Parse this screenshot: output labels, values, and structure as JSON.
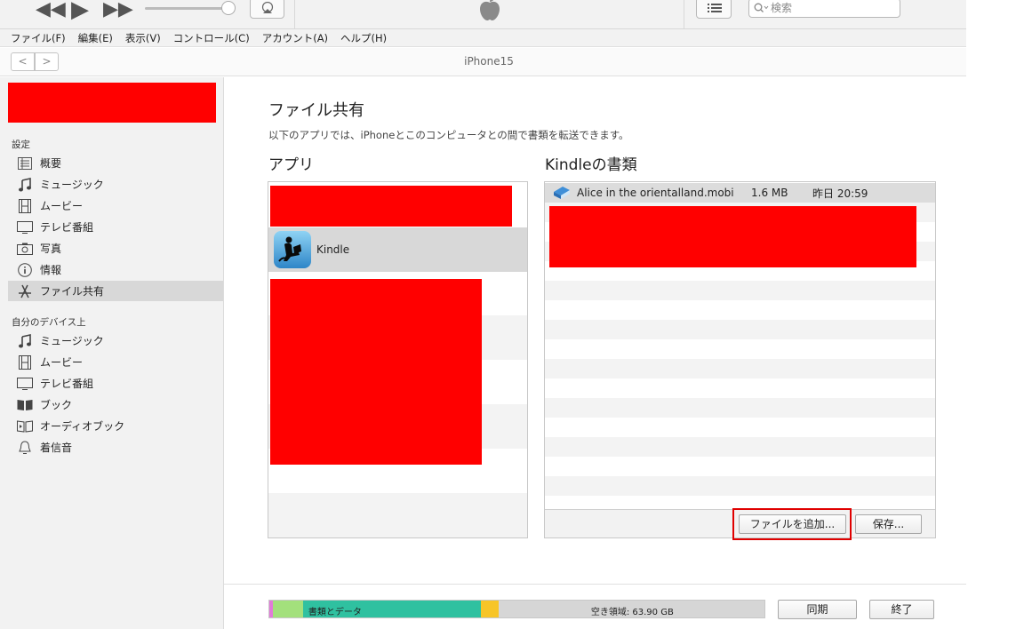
{
  "toolbar": {
    "search_placeholder": "検索"
  },
  "menu": [
    "ファイル(F)",
    "編集(E)",
    "表示(V)",
    "コントロール(C)",
    "アカウント(A)",
    "ヘルプ(H)"
  ],
  "nav": {
    "back": "<",
    "forward": ">",
    "device_title": "iPhone15"
  },
  "sidebar": {
    "settings_header": "設定",
    "settings_items": [
      {
        "label": "概要",
        "icon": "summary-icon"
      },
      {
        "label": "ミュージック",
        "icon": "music-note-icon"
      },
      {
        "label": "ムービー",
        "icon": "film-icon"
      },
      {
        "label": "テレビ番組",
        "icon": "tv-icon"
      },
      {
        "label": "写真",
        "icon": "camera-icon"
      },
      {
        "label": "情報",
        "icon": "info-icon"
      },
      {
        "label": "ファイル共有",
        "icon": "app-store-icon",
        "selected": true
      }
    ],
    "device_header": "自分のデバイス上",
    "device_items": [
      {
        "label": "ミュージック",
        "icon": "music-note-icon"
      },
      {
        "label": "ムービー",
        "icon": "film-icon"
      },
      {
        "label": "テレビ番組",
        "icon": "tv-icon"
      },
      {
        "label": "ブック",
        "icon": "book-icon"
      },
      {
        "label": "オーディオブック",
        "icon": "audiobook-icon"
      },
      {
        "label": "着信音",
        "icon": "bell-icon"
      }
    ]
  },
  "main": {
    "title": "ファイル共有",
    "description": "以下のアプリでは、iPhoneとこのコンピュータとの間で書類を転送できます。",
    "apps_header": "アプリ",
    "apps": [
      {
        "name": "Kindle",
        "selected": true
      }
    ],
    "docs_header": "Kindleの書類",
    "documents": [
      {
        "name": "Alice in the orientalland.mobi",
        "size": "1.6 MB",
        "date": "昨日 20:59"
      }
    ],
    "add_file_button": "ファイルを追加...",
    "save_button": "保存..."
  },
  "storage": {
    "segments": [
      {
        "label": "",
        "color": "#e27ad9",
        "fraction": 0.008
      },
      {
        "label": "",
        "color": "#a3e07c",
        "fraction": 0.06
      },
      {
        "label": "書類とデータ",
        "color": "#2fc1a0",
        "fraction": 0.36
      },
      {
        "label": "",
        "color": "#f7c528",
        "fraction": 0.035
      }
    ],
    "free_label": "空き領域: 63.90 GB",
    "free_color": "#d6d6d6"
  },
  "footer": {
    "sync_button": "同期",
    "done_button": "終了"
  }
}
